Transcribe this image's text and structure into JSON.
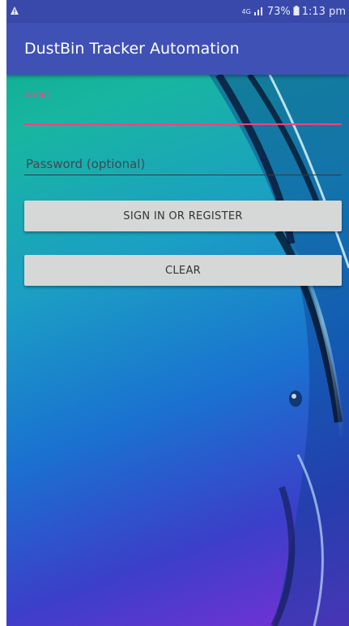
{
  "status_bar": {
    "warning_icon": "warning-icon",
    "network": "4G",
    "signal_icon": "signal-icon",
    "battery_percent": "73%",
    "battery_icon": "battery-icon",
    "time": "1:13 pm"
  },
  "app_bar": {
    "title": "DustBin Tracker Automation"
  },
  "form": {
    "email": {
      "label": "Email",
      "value": ""
    },
    "password": {
      "placeholder": "Password (optional)",
      "value": ""
    },
    "sign_in_button": "SIGN IN OR REGISTER",
    "clear_button": "CLEAR"
  },
  "colors": {
    "status_bar": "#3949ab",
    "app_bar": "#3f51b5",
    "accent": "#ff4081",
    "button": "#d6d7d7"
  }
}
